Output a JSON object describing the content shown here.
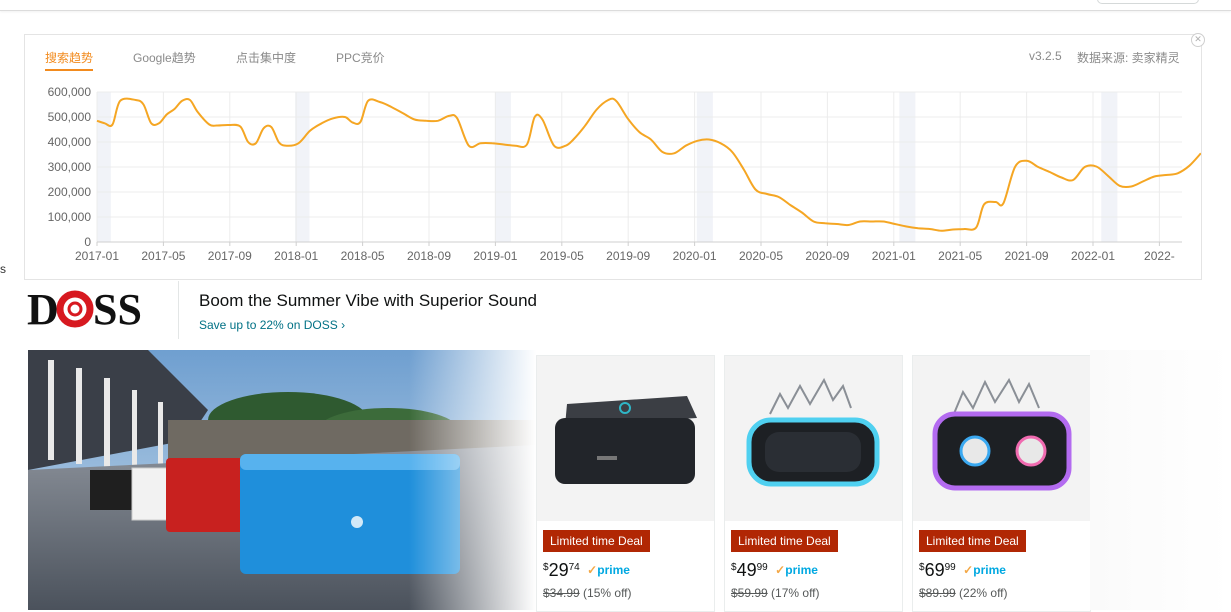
{
  "widget": {
    "tabs": [
      {
        "label": "搜索趋势",
        "active": true
      },
      {
        "label": "Google趋势",
        "active": false
      },
      {
        "label": "点击集中度",
        "active": false
      },
      {
        "label": "PPC竞价",
        "active": false
      }
    ],
    "version": "v3.2.5",
    "source": "数据来源: 卖家精灵",
    "close_icon": "close-icon",
    "accent": "#f28b1e"
  },
  "chart_data": {
    "type": "line",
    "title": "",
    "xlabel": "",
    "ylabel": "",
    "ylim": [
      0,
      600000
    ],
    "yticks": [
      "0",
      "100,000",
      "200,000",
      "300,000",
      "400,000",
      "500,000",
      "600,000"
    ],
    "xticks": [
      "2017-01",
      "2017-05",
      "2017-09",
      "2018-01",
      "2018-05",
      "2018-09",
      "2019-01",
      "2019-05",
      "2019-09",
      "2020-01",
      "2020-05",
      "2020-09",
      "2021-01",
      "2021-05",
      "2021-09",
      "2022-01",
      "2022-"
    ],
    "grid": true,
    "series": [
      {
        "color": "#f5a623",
        "points": [
          [
            "2016-12-31",
            485000
          ],
          [
            "2017-01-14",
            475000
          ],
          [
            "2017-01-28",
            470000
          ],
          [
            "2017-02-11",
            565000
          ],
          [
            "2017-03-11",
            568000
          ],
          [
            "2017-03-25",
            550000
          ],
          [
            "2017-04-08",
            475000
          ],
          [
            "2017-04-22",
            475000
          ],
          [
            "2017-05-06",
            510000
          ],
          [
            "2017-05-20",
            532000
          ],
          [
            "2017-06-03",
            565000
          ],
          [
            "2017-06-17",
            568000
          ],
          [
            "2017-07-01",
            520000
          ],
          [
            "2017-07-22",
            470000
          ],
          [
            "2017-08-05",
            466000
          ],
          [
            "2017-08-26",
            468000
          ],
          [
            "2017-09-16",
            462000
          ],
          [
            "2017-09-30",
            400000
          ],
          [
            "2017-10-14",
            395000
          ],
          [
            "2017-10-28",
            455000
          ],
          [
            "2017-11-11",
            460000
          ],
          [
            "2017-11-25",
            398000
          ],
          [
            "2017-12-09",
            385000
          ],
          [
            "2017-12-30",
            395000
          ],
          [
            "2018-01-20",
            445000
          ],
          [
            "2018-02-10",
            475000
          ],
          [
            "2018-03-03",
            495000
          ],
          [
            "2018-03-24",
            500000
          ],
          [
            "2018-04-07",
            478000
          ],
          [
            "2018-04-21",
            480000
          ],
          [
            "2018-05-05",
            565000
          ],
          [
            "2018-05-26",
            560000
          ],
          [
            "2018-06-16",
            540000
          ],
          [
            "2018-07-07",
            515000
          ],
          [
            "2018-07-28",
            490000
          ],
          [
            "2018-08-18",
            485000
          ],
          [
            "2018-09-08",
            485000
          ],
          [
            "2018-09-29",
            505000
          ],
          [
            "2018-10-13",
            495000
          ],
          [
            "2018-11-03",
            385000
          ],
          [
            "2018-11-24",
            395000
          ],
          [
            "2018-12-15",
            395000
          ],
          [
            "2019-01-05",
            390000
          ],
          [
            "2019-01-26",
            385000
          ],
          [
            "2019-02-16",
            390000
          ],
          [
            "2019-03-02",
            500000
          ],
          [
            "2019-03-16",
            490000
          ],
          [
            "2019-04-06",
            385000
          ],
          [
            "2019-04-27",
            385000
          ],
          [
            "2019-05-11",
            410000
          ],
          [
            "2019-06-01",
            465000
          ],
          [
            "2019-06-22",
            530000
          ],
          [
            "2019-07-13",
            568000
          ],
          [
            "2019-07-27",
            565000
          ],
          [
            "2019-08-17",
            495000
          ],
          [
            "2019-09-07",
            440000
          ],
          [
            "2019-09-28",
            410000
          ],
          [
            "2019-10-19",
            360000
          ],
          [
            "2019-11-09",
            355000
          ],
          [
            "2019-11-30",
            385000
          ],
          [
            "2019-12-21",
            405000
          ],
          [
            "2020-01-11",
            410000
          ],
          [
            "2020-02-01",
            395000
          ],
          [
            "2020-02-22",
            360000
          ],
          [
            "2020-03-14",
            290000
          ],
          [
            "2020-04-04",
            210000
          ],
          [
            "2020-04-25",
            192000
          ],
          [
            "2020-05-16",
            180000
          ],
          [
            "2020-06-06",
            148000
          ],
          [
            "2020-06-27",
            118000
          ],
          [
            "2020-07-18",
            82000
          ],
          [
            "2020-08-08",
            75000
          ],
          [
            "2020-08-29",
            72000
          ],
          [
            "2020-09-19",
            68000
          ],
          [
            "2020-10-10",
            82000
          ],
          [
            "2020-10-31",
            82000
          ],
          [
            "2020-11-21",
            82000
          ],
          [
            "2020-12-12",
            72000
          ],
          [
            "2021-01-02",
            62000
          ],
          [
            "2021-01-23",
            55000
          ],
          [
            "2021-02-13",
            52000
          ],
          [
            "2021-03-06",
            45000
          ],
          [
            "2021-03-27",
            50000
          ],
          [
            "2021-04-17",
            52000
          ],
          [
            "2021-05-08",
            58000
          ],
          [
            "2021-05-22",
            150000
          ],
          [
            "2021-06-12",
            160000
          ],
          [
            "2021-06-26",
            155000
          ],
          [
            "2021-07-17",
            300000
          ],
          [
            "2021-08-07",
            325000
          ],
          [
            "2021-08-28",
            300000
          ],
          [
            "2021-09-18",
            280000
          ],
          [
            "2021-10-09",
            258000
          ],
          [
            "2021-10-30",
            248000
          ],
          [
            "2021-11-20",
            300000
          ],
          [
            "2021-12-11",
            302000
          ],
          [
            "2022-01-01",
            265000
          ],
          [
            "2022-01-22",
            225000
          ],
          [
            "2022-02-12",
            222000
          ],
          [
            "2022-03-05",
            242000
          ],
          [
            "2022-03-26",
            262000
          ],
          [
            "2022-04-16",
            268000
          ],
          [
            "2022-05-07",
            275000
          ],
          [
            "2022-05-28",
            305000
          ],
          [
            "2022-06-18",
            355000
          ]
        ]
      }
    ],
    "shaded_bands": [
      [
        "2016-12-31",
        "2017-01-25"
      ],
      [
        "2017-12-24",
        "2018-01-19"
      ],
      [
        "2018-12-20",
        "2019-01-18"
      ],
      [
        "2019-12-20",
        "2020-01-18"
      ],
      [
        "2020-12-20",
        "2021-01-18"
      ],
      [
        "2021-12-20",
        "2022-01-18"
      ]
    ]
  },
  "brand": {
    "logo_text": "DOSS",
    "title": "Boom the Summer Vibe with Superior Sound",
    "link": "Save up to 22% on DOSS ›"
  },
  "products": [
    {
      "name": "doss-soundbox-black",
      "deal": "Limited time Deal",
      "currency": "$",
      "whole": "29",
      "fraction": "74",
      "prime": "prime",
      "was": "$34.99",
      "off": "(15% off)"
    },
    {
      "name": "doss-soundbox-pro-blue",
      "deal": "Limited time Deal",
      "currency": "$",
      "whole": "49",
      "fraction": "99",
      "prime": "prime",
      "was": "$59.99",
      "off": "(17% off)"
    },
    {
      "name": "doss-soundbox-pro-plus",
      "deal": "Limited time Deal",
      "currency": "$",
      "whole": "69",
      "fraction": "99",
      "prime": "prime",
      "was": "$89.99",
      "off": "(22% off)"
    }
  ],
  "edge_text": "s"
}
